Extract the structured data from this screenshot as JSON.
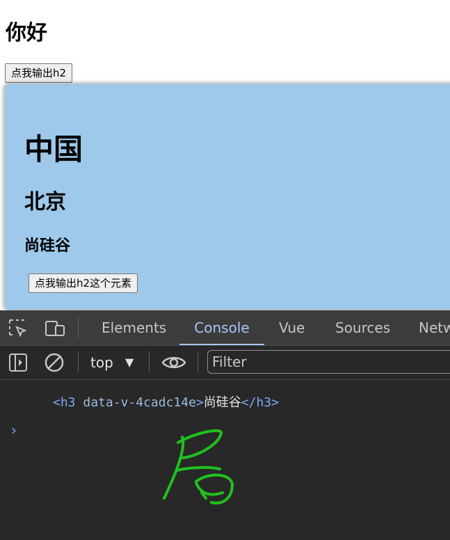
{
  "page": {
    "heading": "你好",
    "top_button": "点我输出h2"
  },
  "card": {
    "h1": "中国",
    "h2": "北京",
    "h3": "尚硅谷",
    "button": "点我输出h2这个元素",
    "background": "#9ec9ea"
  },
  "devtools": {
    "tabs": [
      {
        "label": "Elements",
        "active": false
      },
      {
        "label": "Console",
        "active": true
      },
      {
        "label": "Vue",
        "active": false
      },
      {
        "label": "Sources",
        "active": false
      },
      {
        "label": "Netw",
        "active": false
      }
    ],
    "icons": [
      "inspect-element-icon",
      "device-toolbar-icon",
      "sidebar-toggle-icon",
      "clear-console-icon",
      "eye-icon"
    ],
    "context": "top",
    "filter_placeholder": "Filter",
    "console_output": {
      "open_tag": "<h3",
      "attribute": "data-v-4cadc14e",
      "close_bracket": ">",
      "text": "尚硅谷",
      "end_tag": "</h3>"
    },
    "accent": "#a8c7fa",
    "annotation_color": "#1fc11f"
  }
}
